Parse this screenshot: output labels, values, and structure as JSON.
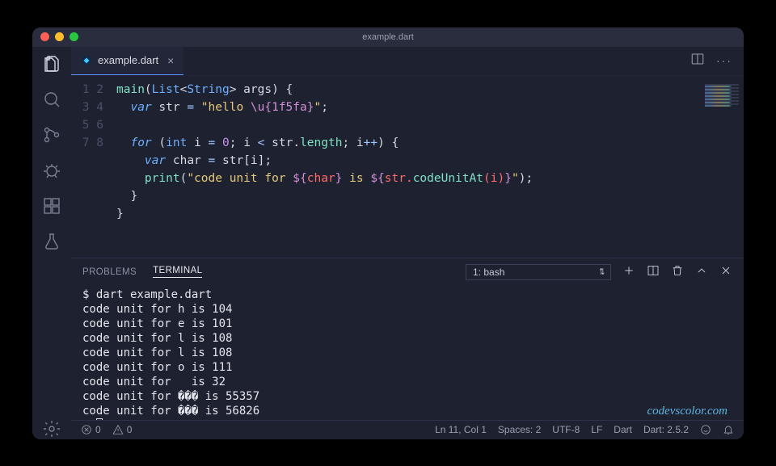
{
  "window": {
    "title": "example.dart"
  },
  "tab": {
    "filename": "example.dart"
  },
  "editor": {
    "lines": [
      1,
      2,
      3,
      4,
      5,
      6,
      7,
      8
    ]
  },
  "code": {
    "l1_main": "main",
    "l1_list": "List",
    "l1_string": "String",
    "l1_args": " args) {",
    "l2_var": "var",
    "l2_str": " str ",
    "l2_eq": "=",
    "l2_lit_a": " \"hello ",
    "l2_esc": "\\u{1f5fa}",
    "l2_lit_b": "\"",
    "l2_semi": ";",
    "l4_for": "for",
    "l4_int": "int",
    "l4_a": " i ",
    "l4_eq": "=",
    "l4_zero": " 0",
    "l4_b": "; i ",
    "l4_lt": "<",
    "l4_c": " str.",
    "l4_len": "length",
    "l4_d": "; i",
    "l4_pp": "++",
    "l4_e": ") {",
    "l5_var": "var",
    "l5_a": " char ",
    "l5_eq": "=",
    "l5_b": " str[i];",
    "l6_print": "print",
    "l6_a": "(",
    "l6_s1": "\"code unit for ",
    "l6_i1o": "${",
    "l6_char": "char",
    "l6_i1c": "}",
    "l6_s2": " is ",
    "l6_i2o": "${",
    "l6_expr_a": "str.",
    "l6_cu": "codeUnitAt",
    "l6_expr_b": "(i)",
    "l6_i2c": "}",
    "l6_s3": "\"",
    "l6_b": ");",
    "l7": "}",
    "l8": "}"
  },
  "panel": {
    "tabs": {
      "problems": "PROBLEMS",
      "terminal": "TERMINAL"
    },
    "select": "1: bash"
  },
  "terminal": {
    "cmd": "$ dart example.dart",
    "lines": [
      "code unit for h is 104",
      "code unit for e is 101",
      "code unit for l is 108",
      "code unit for l is 108",
      "code unit for o is 111",
      "code unit for   is 32",
      "code unit for ��� is 55357",
      "code unit for ��� is 56826"
    ],
    "prompt": "$ "
  },
  "watermark": "codevscolor.com",
  "status": {
    "errors": "0",
    "warnings": "0",
    "pos": "Ln 11, Col 1",
    "spaces": "Spaces: 2",
    "enc": "UTF-8",
    "eol": "LF",
    "lang": "Dart",
    "sdk": "Dart: 2.5.2"
  }
}
